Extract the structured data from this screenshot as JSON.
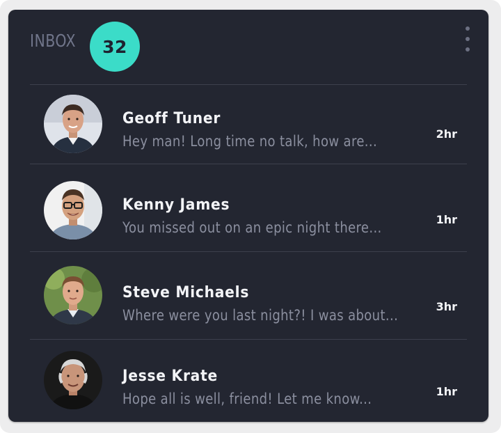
{
  "inbox": {
    "title": "INBOX",
    "count": "32"
  },
  "colors": {
    "card_background": "#232631",
    "badge": "#3bdcc8",
    "name_text": "#f3f4f7",
    "preview_text": "#8b8f9f"
  },
  "messages": [
    {
      "name": "Geoff Tuner",
      "preview": "Hey man! Long time no talk, how are...",
      "time": "2hr",
      "avatar_icon": "avatar-photo"
    },
    {
      "name": "Kenny James",
      "preview": "You missed out on an epic night there...",
      "time": "1hr",
      "avatar_icon": "avatar-photo"
    },
    {
      "name": "Steve Michaels",
      "preview": "Where were you last night?! I was about...",
      "time": "3hr",
      "avatar_icon": "avatar-photo"
    },
    {
      "name": "Jesse Krate",
      "preview": "Hope all is well, friend! Let me know...",
      "time": "1hr",
      "avatar_icon": "avatar-photo"
    }
  ]
}
